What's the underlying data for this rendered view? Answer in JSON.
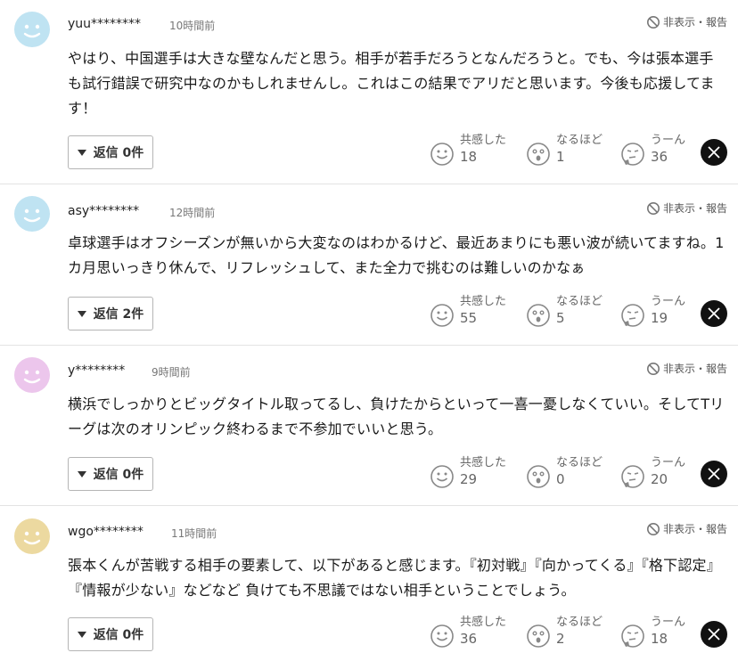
{
  "report_label": "非表示・報告",
  "reply_prefix": "返信",
  "reaction_labels": {
    "empathy": "共感した",
    "naruhodo": "なるほど",
    "uun": "うーん"
  },
  "comments": [
    {
      "username": "yuu********",
      "time": "10時間前",
      "avatar_color": "#bfe3f2",
      "avatar_mood": "smile",
      "body": "やはり、中国選手は大きな壁なんだと思う。相手が若手だろうとなんだろうと。でも、今は張本選手も試行錯誤で研究中なのかもしれませんし。これはこの結果でアリだと思います。今後も応援してます！",
      "reply_label": "返信 0件",
      "empathy": "18",
      "naruhodo": "1",
      "uun": "36"
    },
    {
      "username": "asy********",
      "time": "12時間前",
      "avatar_color": "#bfe3f2",
      "avatar_mood": "smile",
      "body": "卓球選手はオフシーズンが無いから大変なのはわかるけど、最近あまりにも悪い波が続いてますね。1カ月思いっきり休んで、リフレッシュして、また全力で挑むのは難しいのかなぁ",
      "reply_label": "返信 2件",
      "empathy": "55",
      "naruhodo": "5",
      "uun": "19"
    },
    {
      "username": "y********",
      "time": "9時間前",
      "avatar_color": "#ecc6ec",
      "avatar_mood": "smile",
      "body": "横浜でしっかりとビッグタイトル取ってるし、負けたからといって一喜一憂しなくていい。そしてTリーグは次のオリンピック終わるまで不参加でいいと思う。",
      "reply_label": "返信 0件",
      "empathy": "29",
      "naruhodo": "0",
      "uun": "20"
    },
    {
      "username": "wgo********",
      "time": "11時間前",
      "avatar_color": "#ecd9a0",
      "avatar_mood": "smile",
      "body": "張本くんが苦戦する相手の要素して、以下があると感じます。『初対戦』『向かってくる』『格下認定』『情報が少ない』などなど 負けても不思議ではない相手ということでしょう。",
      "reply_label": "返信 0件",
      "empathy": "36",
      "naruhodo": "2",
      "uun": "18"
    }
  ]
}
